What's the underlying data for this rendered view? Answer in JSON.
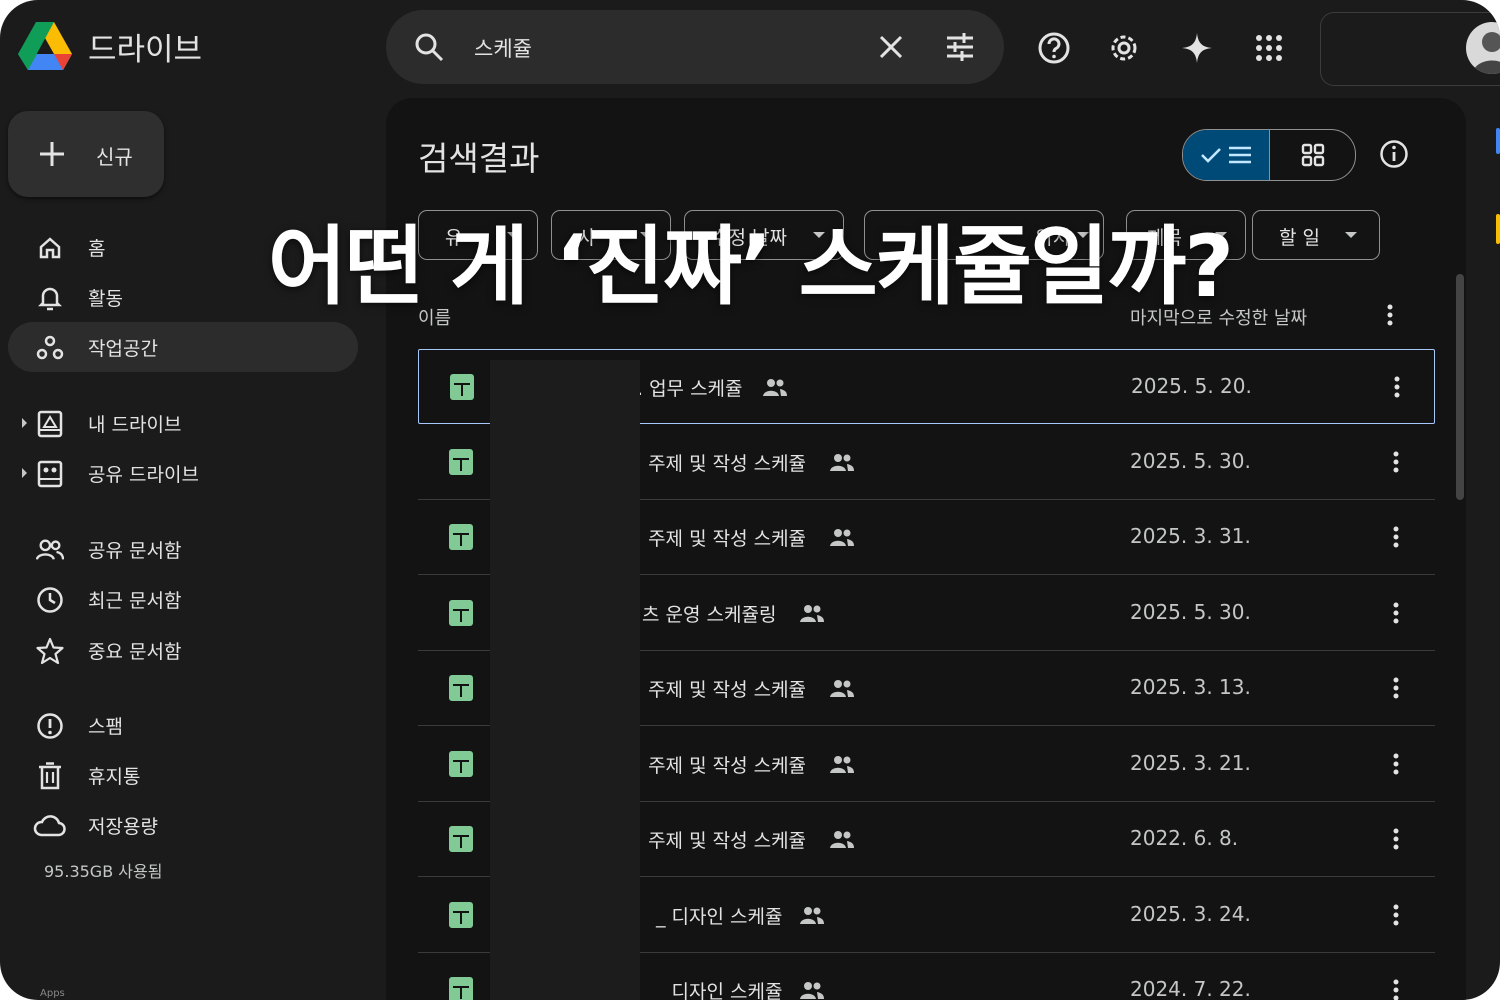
{
  "app": {
    "title": "드라이브"
  },
  "search": {
    "query": "스케쥴"
  },
  "new_button": {
    "label": "신규"
  },
  "sidebar": {
    "items": [
      {
        "label": "홈",
        "icon": "home-icon"
      },
      {
        "label": "활동",
        "icon": "bell-icon"
      },
      {
        "label": "작업공간",
        "icon": "workspace-icon",
        "active": true
      },
      {
        "label": "내 드라이브",
        "icon": "my-drive-icon"
      },
      {
        "label": "공유 드라이브",
        "icon": "shared-drive-icon"
      },
      {
        "label": "공유 문서함",
        "icon": "people-icon"
      },
      {
        "label": "최근 문서함",
        "icon": "clock-icon"
      },
      {
        "label": "중요 문서함",
        "icon": "star-icon"
      },
      {
        "label": "스팸",
        "icon": "spam-icon"
      },
      {
        "label": "휴지통",
        "icon": "trash-icon"
      },
      {
        "label": "저장용량",
        "icon": "cloud-icon"
      }
    ],
    "storage_used": "95.35GB 사용됨",
    "bottom_label": "Apps"
  },
  "main": {
    "title": "검색결과",
    "chips": [
      {
        "label": "유"
      },
      {
        "label": "사"
      },
      {
        "label": "수정 날짜"
      },
      {
        "label": "위치"
      },
      {
        "label": "제목"
      },
      {
        "label": "할 일"
      }
    ],
    "columns": {
      "name": "이름",
      "modified": "마지막으로 수정한 날짜"
    },
    "files": [
      {
        "name": ". 업무 스케쥴",
        "date": "2025. 5. 20.",
        "selected": true
      },
      {
        "name": ". 주제 및 작성 스케쥴",
        "date": "2025. 5. 30."
      },
      {
        "name": ". 주제 및 작성 스케쥴",
        "date": "2025. 3. 31."
      },
      {
        "name": "츠 운영 스케쥴링",
        "date": "2025. 5. 30."
      },
      {
        "name": ". 주제 및 작성 스케쥴",
        "date": "2025. 3. 13."
      },
      {
        "name": ". 주제 및 작성 스케쥴",
        "date": "2025. 3. 21."
      },
      {
        "name": ". 주제 및 작성 스케쥴",
        "date": "2022. 6. 8."
      },
      {
        "name": "_ 디자인 스케쥴",
        "date": "2025. 3. 24."
      },
      {
        "name": "_ 디자인 스케쥴",
        "date": "2024. 7. 22."
      }
    ]
  },
  "overlay": {
    "text": "어떤 게 ‘진짜’ 스케쥴일까?"
  },
  "colors": {
    "background": "#1b1b1b",
    "panel": "#131313",
    "accent": "#004a77",
    "sheet_green": "#81c995",
    "text": "#e3e3e3"
  }
}
